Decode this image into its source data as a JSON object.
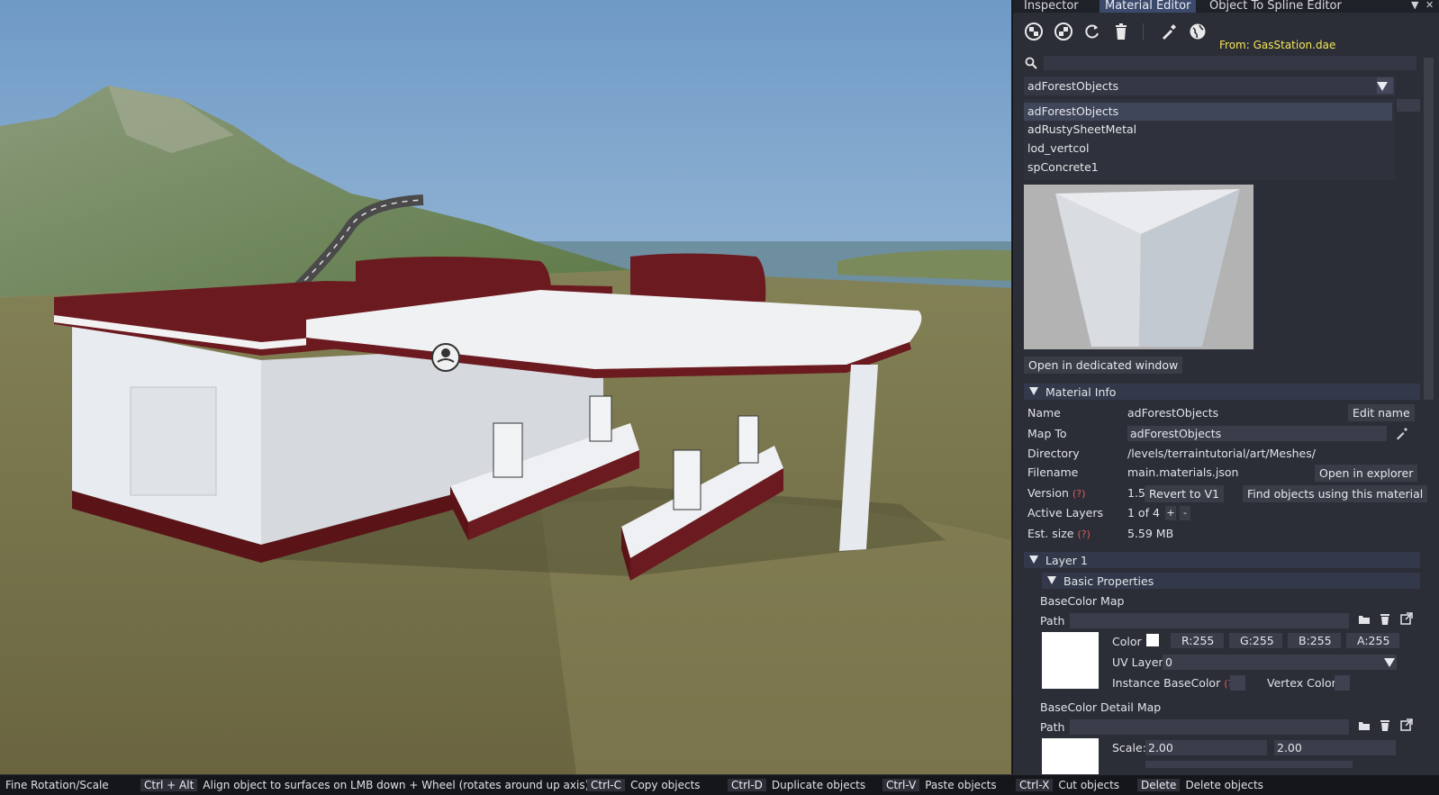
{
  "tabs": [
    {
      "label": "Inspector"
    },
    {
      "label": "Material Editor"
    },
    {
      "label": "Object To Spline Editor"
    }
  ],
  "toolbar": {
    "source_label": "From: GasStation.dae",
    "icons": [
      "material-sphere-icon",
      "material-sphere-alt-icon",
      "refresh-icon",
      "trash-icon",
      "eyedropper-icon",
      "globe-icon"
    ]
  },
  "material_select": {
    "selected": "adForestObjects",
    "options": [
      "adForestObjects",
      "adRustySheetMetal",
      "lod_vertcol",
      "spConcrete1"
    ]
  },
  "preview": {
    "open_button": "Open in dedicated window"
  },
  "material_info": {
    "header": "Material Info",
    "name_label": "Name",
    "name_value": "adForestObjects",
    "edit_name": "Edit name",
    "mapto_label": "Map To",
    "mapto_value": "adForestObjects",
    "directory_label": "Directory",
    "directory_value": "/levels/terraintutorial/art/Meshes/",
    "filename_label": "Filename",
    "filename_value": "main.materials.json",
    "open_explorer": "Open in explorer",
    "version_label": "Version",
    "help_mark": "(?)",
    "version_value": "1.5",
    "revert": "Revert to V1",
    "find_objects": "Find objects using this material",
    "active_layers_label": "Active Layers",
    "active_layers_value": "1 of 4",
    "plus": "+",
    "minus": "-",
    "est_size_label": "Est. size",
    "est_size_value": "5.59 MB"
  },
  "layer": {
    "header": "Layer 1",
    "basic_props": "Basic Properties",
    "basecolor_map": "BaseColor Map",
    "path_label": "Path",
    "color_label": "Color",
    "r": "R:255",
    "g": "G:255",
    "b": "B:255",
    "a": "A:255",
    "uv_label": "UV Layer",
    "uv_value": "0",
    "instance_label": "Instance BaseColor",
    "vertex_label": "Vertex Color",
    "detail_map": "BaseColor Detail Map",
    "path_label2": "Path",
    "scale_label": "Scale:",
    "scale_x": "2.00",
    "scale_y": "2.00"
  },
  "statusbar": [
    {
      "key": "",
      "text": "Fine Rotation/Scale"
    },
    {
      "key": "Ctrl + Alt",
      "text": "Align object to surfaces on LMB down + Wheel (rotates around up axis)"
    },
    {
      "key": "Ctrl-C",
      "text": "Copy objects"
    },
    {
      "key": "Ctrl-D",
      "text": "Duplicate objects"
    },
    {
      "key": "Ctrl-V",
      "text": "Paste objects"
    },
    {
      "key": "Ctrl-X",
      "text": "Cut objects"
    },
    {
      "key": "Delete",
      "text": "Delete objects"
    }
  ],
  "colors": {
    "accent_tab": "#3b4a6b",
    "source_text": "#f4e55a",
    "help_text": "#e15a5a"
  }
}
